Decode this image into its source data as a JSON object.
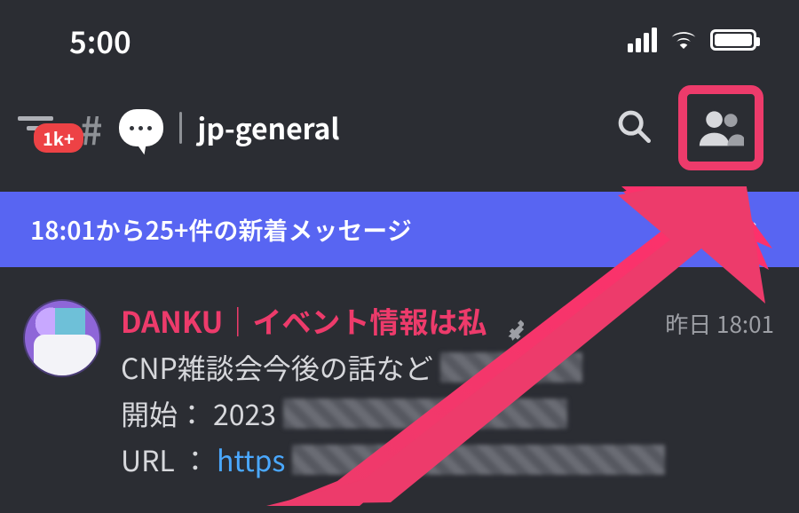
{
  "status": {
    "time": "5:00"
  },
  "header": {
    "unread_badge": "1k+",
    "channel_name": "jp-general"
  },
  "banner": {
    "text": "18:01から25+件の新着メッセージ"
  },
  "message": {
    "author": "DANKU｜イベント情報は私",
    "timestamp": "昨日 18:01",
    "line1_prefix": "CNP雑談会今後の話など",
    "line2_label": "開始：",
    "line2_value": "2023",
    "line3_label": "URL ：",
    "line3_link": "https"
  },
  "colors": {
    "accent_pink": "#ed3b6b",
    "blurple": "#5865f2",
    "danger": "#ed4245"
  }
}
